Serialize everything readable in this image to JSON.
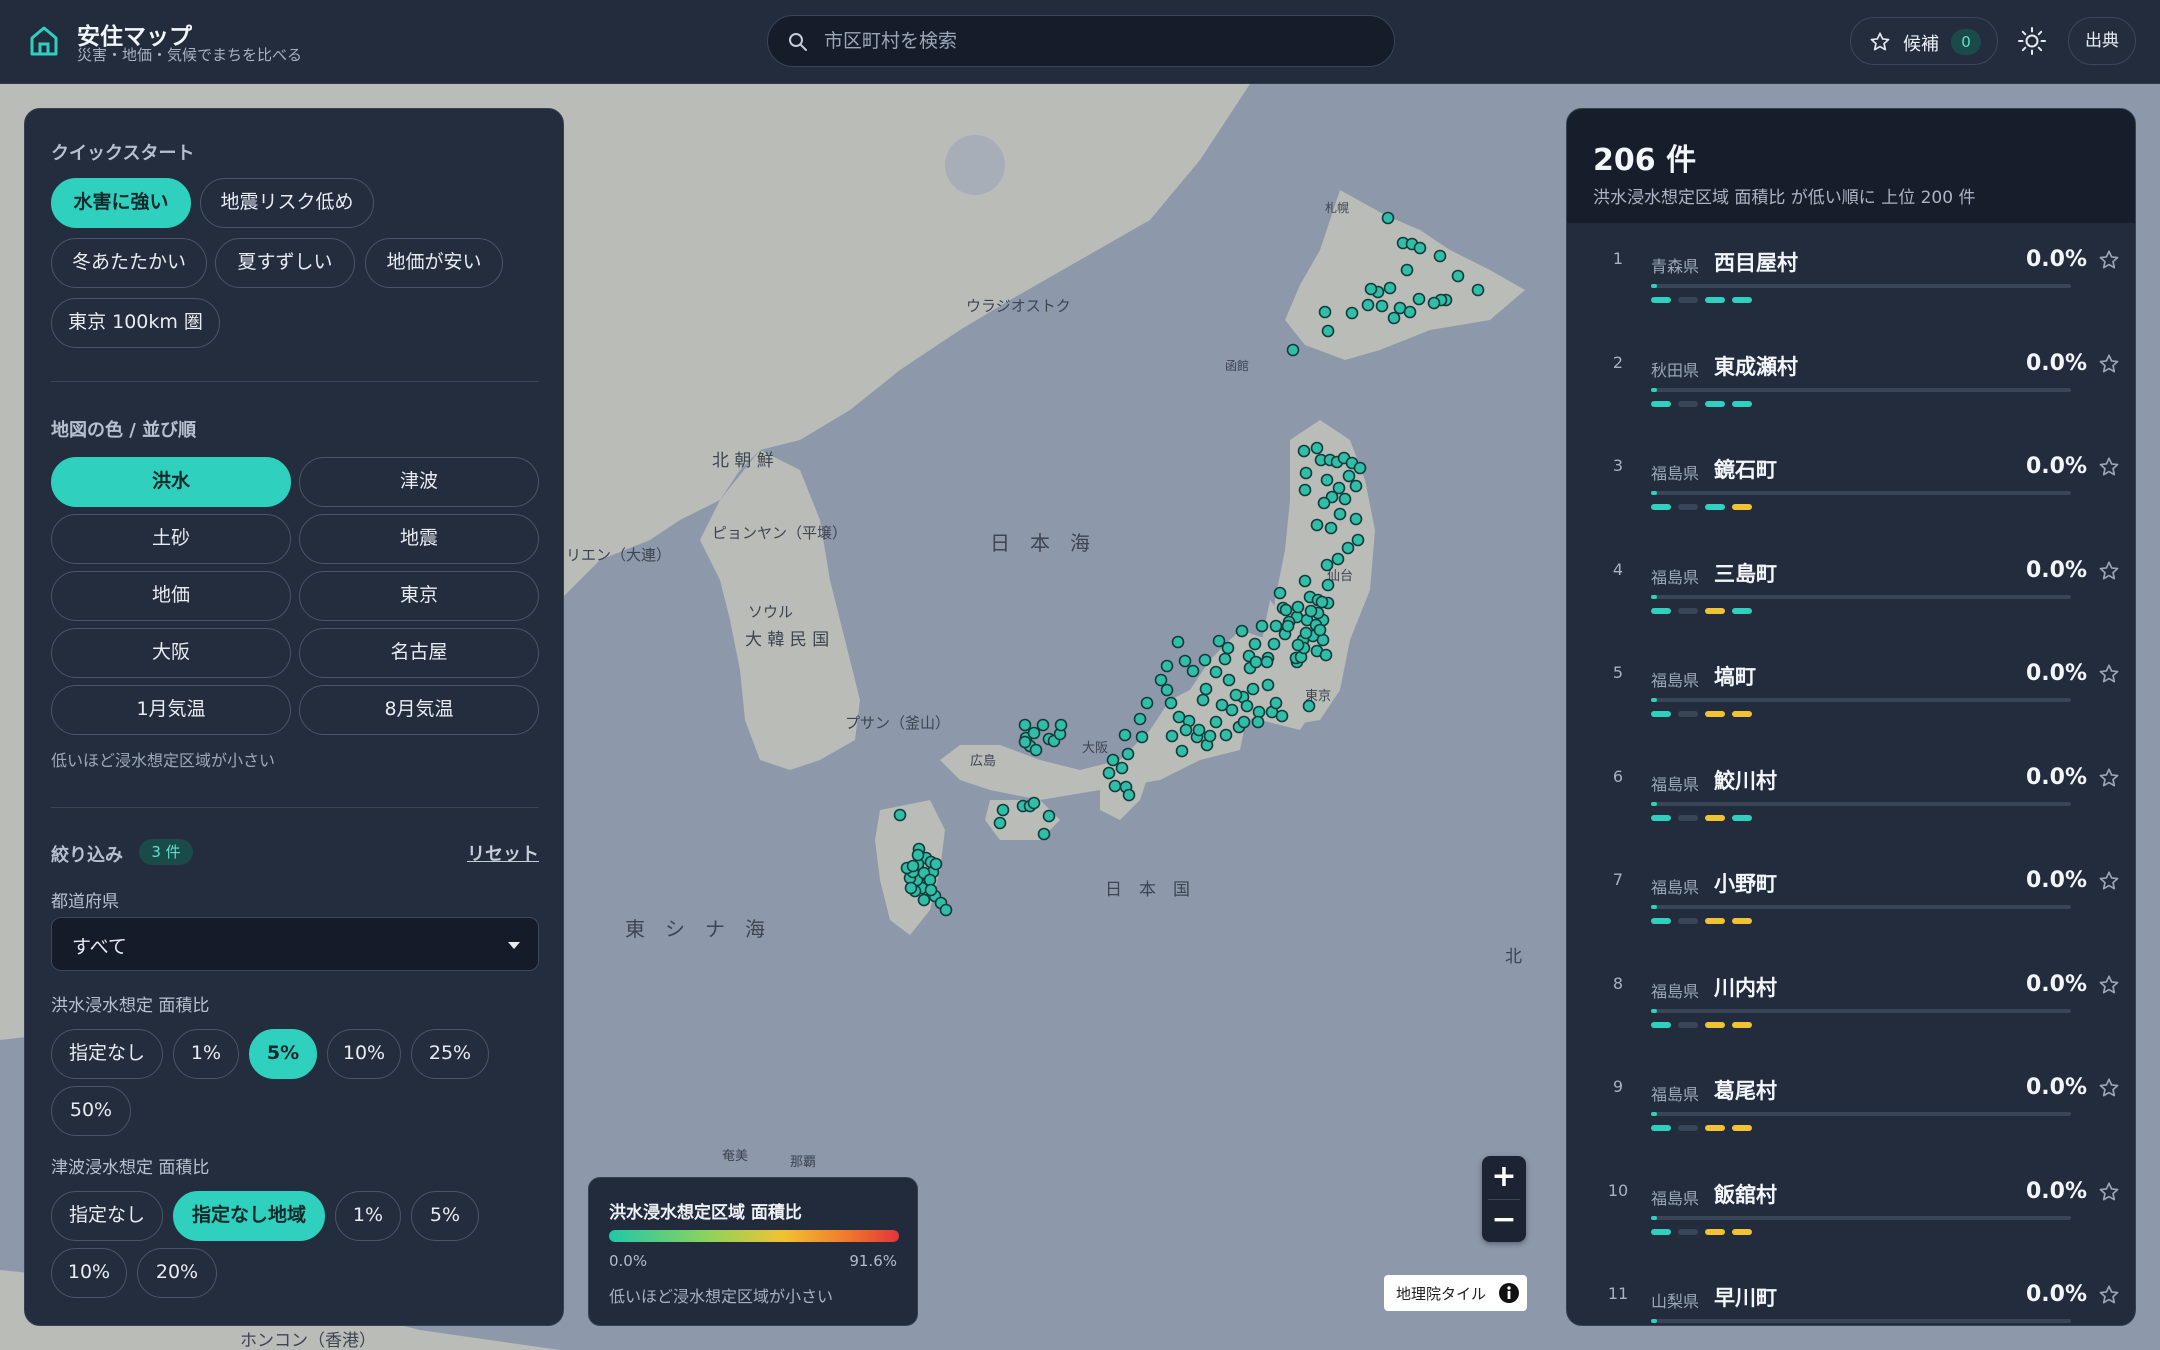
{
  "header": {
    "title": "安住マップ",
    "subtitle": "災害・地価・気候でまちを比べる",
    "search_placeholder": "市区町村を検索",
    "candidates_label": "候補",
    "candidates_count": "0",
    "sources_label": "出典"
  },
  "left": {
    "quickstart_title": "クイックスタート",
    "quickstart": [
      "水害に強い",
      "地震リスク低め",
      "冬あたたかい",
      "夏すずしい",
      "地価が安い",
      "東京 100km 圏"
    ],
    "quickstart_active": 0,
    "colorby_title": "地図の色 / 並び順",
    "colorby": [
      "洪水",
      "津波",
      "土砂",
      "地震",
      "地価",
      "東京",
      "大阪",
      "名古屋",
      "1月気温",
      "8月気温"
    ],
    "colorby_active": 0,
    "colorby_note": "低いほど浸水想定区域が小さい",
    "filter_title": "絞り込み",
    "filter_count": "3 件",
    "reset_label": "リセット",
    "pref_label": "都道府県",
    "pref_value": "すべて",
    "flood_label": "洪水浸水想定 面積比",
    "flood_options": [
      "指定なし",
      "1%",
      "5%",
      "10%",
      "25%",
      "50%"
    ],
    "flood_active": 2,
    "tsunami_label": "津波浸水想定 面積比",
    "tsunami_options": [
      "指定なし",
      "指定なし地域",
      "1%",
      "5%",
      "10%",
      "20%"
    ],
    "tsunami_active": 1
  },
  "legend": {
    "title": "洪水浸水想定区域 面積比",
    "min": "0.0%",
    "max": "91.6%",
    "note": "低いほど浸水想定区域が小さい",
    "colors": [
      "#21c7a8",
      "#8fd35b",
      "#f1c232",
      "#f07a2b",
      "#e0353a"
    ]
  },
  "map": {
    "attribution": "地理院タイル",
    "marker_color": "#2fbfa8",
    "labels": {
      "sea_japan": "日　本　海",
      "east_china": "東　シ　ナ　海",
      "japan": "日　本　国",
      "korea": "大 韓 民 国",
      "nk": "北 朝 鮮",
      "pyongyang": "ピョンヤン（平壌）",
      "seoul": "ソウル",
      "busan": "プサン（釜山）",
      "vladivostok": "ウラジオストク",
      "dalian": "リエン（大連）",
      "hongkong": "ホンコン（香港）",
      "north": "北",
      "amami": "奄美",
      "tokyo": "東京",
      "osaka": "大阪",
      "sendai": "仙台",
      "hiroshima": "広島",
      "hakodate": "函館",
      "sapporo": "札幌",
      "naha": "那覇"
    }
  },
  "results": {
    "count": "206 件",
    "subtitle": "洪水浸水想定区域 面積比 が低い順に 上位 200 件",
    "rows": [
      {
        "rank": "1",
        "pref": "青森県",
        "city": "西目屋村",
        "value": "0.0%",
        "dashes": [
          "t",
          "g",
          "t",
          "t"
        ]
      },
      {
        "rank": "2",
        "pref": "秋田県",
        "city": "東成瀬村",
        "value": "0.0%",
        "dashes": [
          "t",
          "g",
          "t",
          "t"
        ]
      },
      {
        "rank": "3",
        "pref": "福島県",
        "city": "鏡石町",
        "value": "0.0%",
        "dashes": [
          "t",
          "g",
          "t",
          "y"
        ]
      },
      {
        "rank": "4",
        "pref": "福島県",
        "city": "三島町",
        "value": "0.0%",
        "dashes": [
          "t",
          "g",
          "y",
          "t"
        ]
      },
      {
        "rank": "5",
        "pref": "福島県",
        "city": "塙町",
        "value": "0.0%",
        "dashes": [
          "t",
          "g",
          "y",
          "y"
        ]
      },
      {
        "rank": "6",
        "pref": "福島県",
        "city": "鮫川村",
        "value": "0.0%",
        "dashes": [
          "t",
          "g",
          "y",
          "t"
        ]
      },
      {
        "rank": "7",
        "pref": "福島県",
        "city": "小野町",
        "value": "0.0%",
        "dashes": [
          "t",
          "g",
          "y",
          "y"
        ]
      },
      {
        "rank": "8",
        "pref": "福島県",
        "city": "川内村",
        "value": "0.0%",
        "dashes": [
          "t",
          "g",
          "y",
          "y"
        ]
      },
      {
        "rank": "9",
        "pref": "福島県",
        "city": "葛尾村",
        "value": "0.0%",
        "dashes": [
          "t",
          "g",
          "y",
          "y"
        ]
      },
      {
        "rank": "10",
        "pref": "福島県",
        "city": "飯舘村",
        "value": "0.0%",
        "dashes": [
          "t",
          "g",
          "y",
          "y"
        ]
      },
      {
        "rank": "11",
        "pref": "山梨県",
        "city": "早川町",
        "value": "0.0%",
        "dashes": [
          "t",
          "g",
          "t",
          "t"
        ]
      }
    ]
  }
}
